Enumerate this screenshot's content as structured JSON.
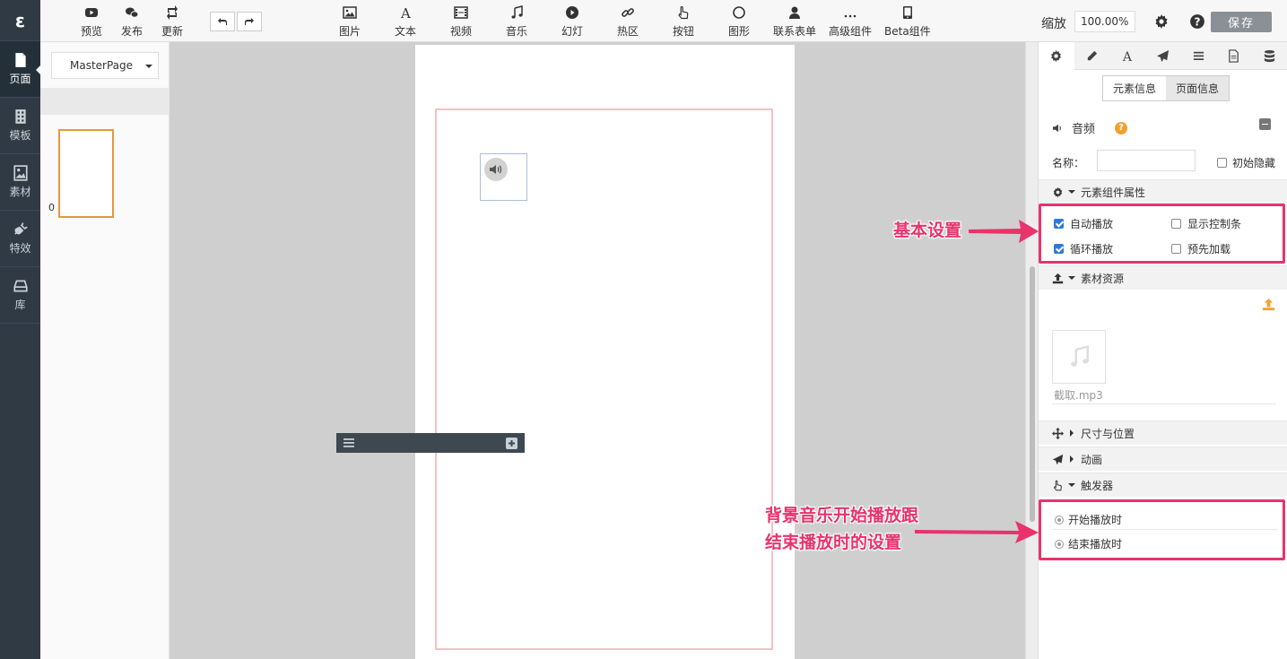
{
  "rail": {
    "logo": "ε",
    "items": [
      {
        "label": "页面",
        "icon": "page-icon"
      },
      {
        "label": "模板",
        "icon": "template-icon"
      },
      {
        "label": "素材",
        "icon": "image-icon"
      },
      {
        "label": "特效",
        "icon": "plug-icon"
      },
      {
        "label": "库",
        "icon": "library-icon"
      }
    ]
  },
  "toolbar": {
    "left_buttons": [
      {
        "label": "预览",
        "icon": "youtube-icon"
      },
      {
        "label": "发布",
        "icon": "wechat-icon"
      },
      {
        "label": "更新",
        "icon": "retweet-icon"
      }
    ],
    "insert_buttons": [
      {
        "label": "图片",
        "icon": "picture-icon"
      },
      {
        "label": "文本",
        "icon": "font-icon"
      },
      {
        "label": "视频",
        "icon": "film-icon"
      },
      {
        "label": "音乐",
        "icon": "music-icon"
      },
      {
        "label": "幻灯",
        "icon": "play-circle-icon"
      },
      {
        "label": "热区",
        "icon": "link-icon"
      },
      {
        "label": "按钮",
        "icon": "hand-pointer-icon"
      },
      {
        "label": "图形",
        "icon": "circle-icon"
      },
      {
        "label": "联系表单",
        "icon": "user-icon"
      },
      {
        "label": "高级组件",
        "icon": "ellipsis-icon"
      },
      {
        "label": "Beta组件",
        "icon": "tablet-icon"
      }
    ],
    "zoom_label": "缩放",
    "zoom_value": "100.00%",
    "save_label": "保存"
  },
  "page_panel": {
    "master_select": "MasterPage",
    "page_number": "0"
  },
  "right_panel": {
    "tabs": [
      "gear-icon",
      "pencil-icon",
      "font-icon",
      "paper-plane-icon",
      "list-icon",
      "file-icon",
      "database-icon"
    ],
    "segments": [
      "元素信息",
      "页面信息"
    ],
    "element_title": "音频",
    "help_glyph": "?",
    "name_label": "名称：",
    "name_value": "",
    "initial_hide_label": "初始隐藏",
    "component_props_title": "元素组件属性",
    "options": {
      "autoplay": {
        "label": "自动播放",
        "checked": true
      },
      "show_controls": {
        "label": "显示控制条",
        "checked": false
      },
      "loop": {
        "label": "循环播放",
        "checked": true
      },
      "preload": {
        "label": "预先加载",
        "checked": false
      }
    },
    "asset_title": "素材资源",
    "asset_name": "截取.mp3",
    "size_position_title": "尺寸与位置",
    "animation_title": "动画",
    "trigger_title": "触发器",
    "triggers": [
      "开始播放时",
      "结束播放时"
    ]
  },
  "annotations": {
    "basic_settings": "基本设置",
    "bg_music_line1": "背景音乐开始播放跟",
    "bg_music_line2": "结束播放时的设置",
    "accent_color": "#e8336c"
  }
}
